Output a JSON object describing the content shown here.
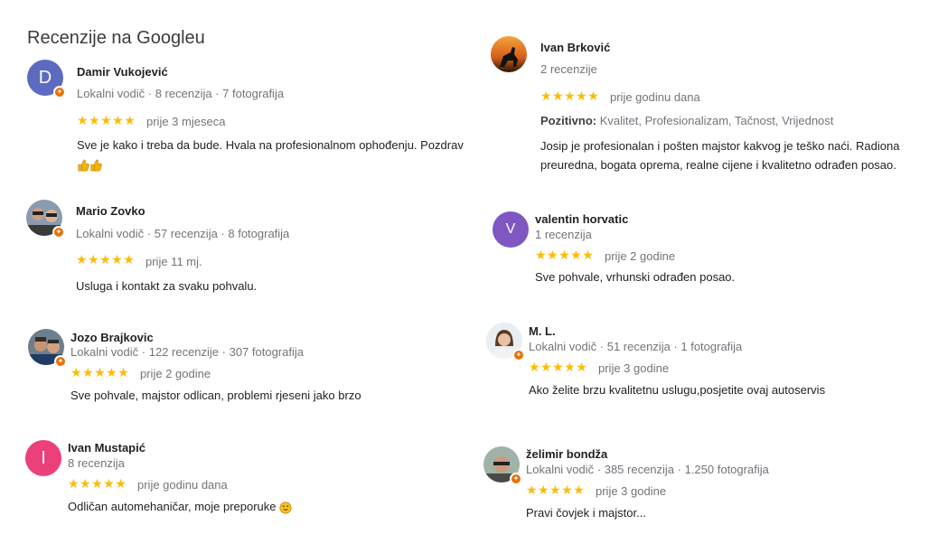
{
  "title": "Recenzije na Googleu",
  "stars": "★★★★★",
  "colors": {
    "star": "#fbbc04",
    "guide_badge": "#e8710a",
    "avatar_d": "#5c6bc0",
    "avatar_v": "#7e57c2",
    "avatar_i": "#ec407a"
  },
  "reviews": [
    {
      "name": "Damir Vukojević",
      "initial": "D",
      "meta": "Lokalni vodič · 8 recenzija · 7 fotografija",
      "when": "prije 3 mjeseca",
      "text": "Sve je kako i treba da bude. Hvala na profesionalnom ophođenju. Pozdrav",
      "icon": "thumbs-up-icon"
    },
    {
      "name": "Mario Zovko",
      "meta": "Lokalni vodič · 57 recenzija · 8 fotografija",
      "when": "prije 11 mj.",
      "text": "Usluga i kontakt za svaku pohvalu."
    },
    {
      "name": "Jozo Brajkovic",
      "meta": "Lokalni vodič · 122 recenzije · 307 fotografija",
      "when": "prije 2 godine",
      "text": "Sve pohvale, majstor odlican, problemi rjeseni jako brzo"
    },
    {
      "name": "Ivan Mustapić",
      "initial": "I",
      "meta": "8 recenzija",
      "when": "prije godinu dana",
      "text": "Odličan automehaničar, moje preporuke",
      "icon": "smiley-icon"
    },
    {
      "name": "Ivan Brković",
      "meta": "2 recenzije",
      "when": "prije godinu dana",
      "positive_label": "Pozitivno:",
      "positive_values": " Kvalitet, Profesionalizam, Tačnost, Vrijednost",
      "text": "Josip je profesionalan i pošten majstor kakvog je teško naći. Radiona preuredna, bogata oprema, realne cijene i kvalitetno odrađen posao."
    },
    {
      "name": "valentin horvatic",
      "initial": "V",
      "meta": "1 recenzija",
      "when": "prije 2 godine",
      "text": "Sve pohvale, vrhunski odrađen posao."
    },
    {
      "name": "M. L.",
      "meta": "Lokalni vodič · 51 recenzija · 1 fotografija",
      "when": "prije 3 godine",
      "text": "Ako želite brzu kvalitetnu uslugu,posjetite ovaj autoservis"
    },
    {
      "name": "želimir bondža",
      "meta": "Lokalni vodič · 385 recenzija · 1.250 fotografija",
      "when": "prije 3 godine",
      "text": "Pravi čovjek i majstor..."
    }
  ]
}
